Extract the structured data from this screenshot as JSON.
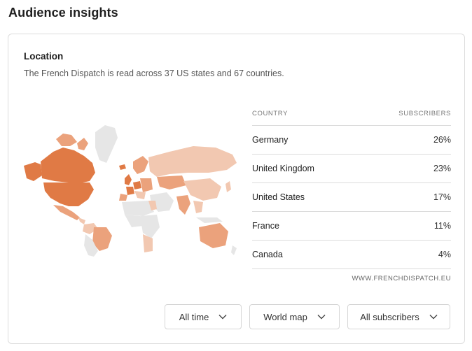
{
  "header": {
    "title": "Audience insights"
  },
  "location": {
    "title": "Location",
    "description": "The French Dispatch is read across 37 US states and 67 countries."
  },
  "table": {
    "col_country": "COUNTRY",
    "col_subscribers": "SUBSCRIBERS",
    "rows": [
      {
        "country": "Germany",
        "share": "26%"
      },
      {
        "country": "United Kingdom",
        "share": "23%"
      },
      {
        "country": "United States",
        "share": "17%"
      },
      {
        "country": "France",
        "share": "11%"
      },
      {
        "country": "Canada",
        "share": "4%"
      }
    ],
    "source": "WWW.FRENCHDISPATCH.EU"
  },
  "filters": {
    "time": "All time",
    "view": "World map",
    "audience": "All subscribers"
  },
  "colors": {
    "strong": "#e07a45",
    "medium": "#eba27c",
    "light": "#f2c8b1",
    "none": "#e6e6e6"
  }
}
